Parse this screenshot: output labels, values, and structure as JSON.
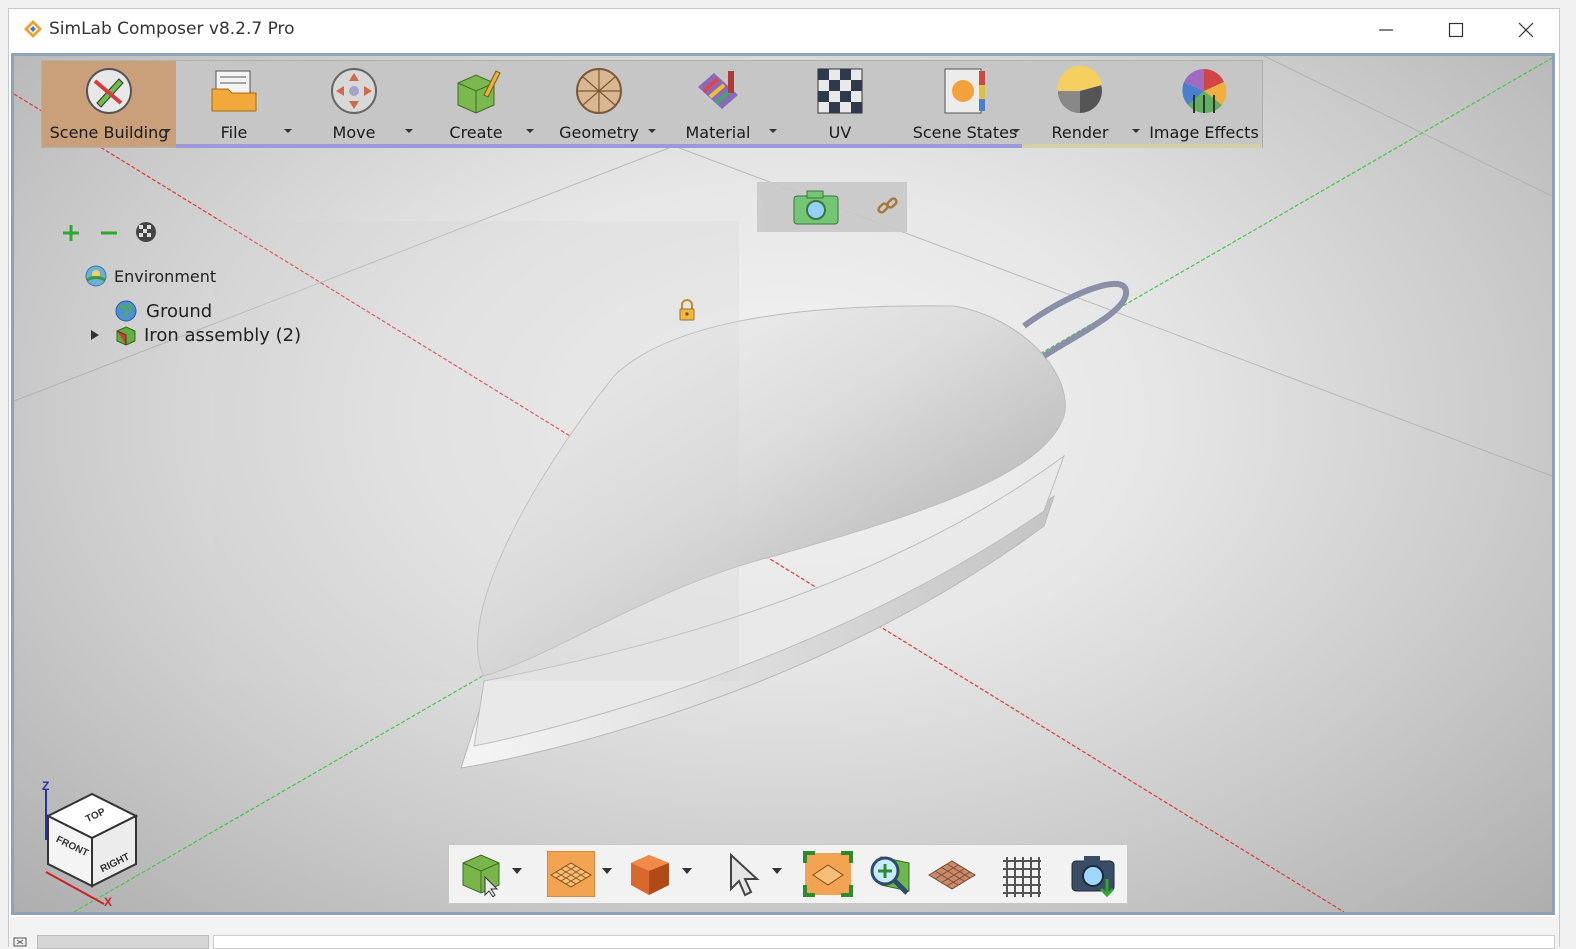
{
  "window": {
    "title": "SimLab Composer v8.2.7 Pro"
  },
  "toolbar": {
    "items": [
      {
        "label": "Scene Building",
        "icon": "scene-building-icon"
      },
      {
        "label": "File",
        "icon": "file-folder-icon"
      },
      {
        "label": "Move",
        "icon": "move-arrows-icon"
      },
      {
        "label": "Create",
        "icon": "create-cube-icon"
      },
      {
        "label": "Geometry",
        "icon": "geometry-sphere-icon"
      },
      {
        "label": "Material",
        "icon": "material-paint-icon"
      },
      {
        "label": "UV",
        "icon": "uv-checker-icon"
      },
      {
        "label": "Scene States",
        "icon": "scene-states-icon"
      },
      {
        "label": "Render",
        "icon": "render-sphere-icon"
      },
      {
        "label": "Image Effects",
        "icon": "image-effects-icon"
      }
    ]
  },
  "tree": {
    "root": "Environment",
    "children": [
      {
        "label": "Ground"
      },
      {
        "label": "Iron assembly (2)"
      }
    ]
  },
  "view_cube": {
    "top": "TOP",
    "front": "FRONT",
    "right": "RIGHT",
    "axis_x": "X",
    "axis_z": "Z"
  },
  "colors": {
    "accent_active": "#c9a07a",
    "axis_red": "#e53935",
    "axis_green": "#43c943",
    "viewport_border": "#8fa3b8"
  }
}
